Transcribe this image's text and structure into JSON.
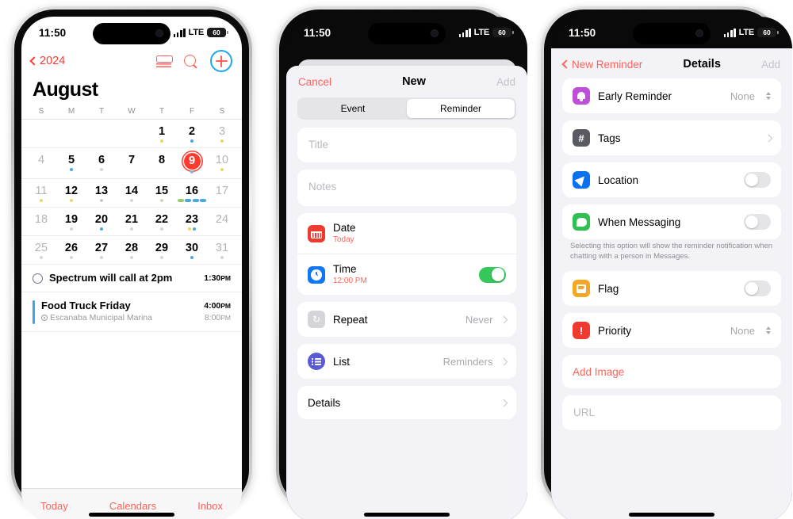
{
  "statusbar": {
    "time": "11:50",
    "network": "LTE",
    "battery": "60"
  },
  "phone1": {
    "nav": {
      "back_label": "2024",
      "icons": [
        "list-icon",
        "search-icon",
        "add-icon"
      ]
    },
    "month": "August",
    "weekday_headers": [
      "S",
      "M",
      "T",
      "W",
      "T",
      "F",
      "S"
    ],
    "weeks": [
      [
        {
          "n": "",
          "dim": true,
          "dots": []
        },
        {
          "n": "",
          "dim": true,
          "dots": []
        },
        {
          "n": "",
          "dim": true,
          "dots": []
        },
        {
          "n": "",
          "dim": true,
          "dots": []
        },
        {
          "n": "1",
          "dim": false,
          "dots": [
            "#e8d86a"
          ]
        },
        {
          "n": "2",
          "dim": false,
          "dots": [
            "#4aa8de"
          ]
        },
        {
          "n": "3",
          "dim": true,
          "dots": [
            "#e8d86a"
          ]
        }
      ],
      [
        {
          "n": "4",
          "dim": true,
          "dots": []
        },
        {
          "n": "5",
          "dim": false,
          "dots": [
            "#4aa8de"
          ]
        },
        {
          "n": "6",
          "dim": false,
          "dots": [
            "#d6d6da"
          ]
        },
        {
          "n": "7",
          "dim": false,
          "dots": []
        },
        {
          "n": "8",
          "dim": false,
          "dots": []
        },
        {
          "n": "9",
          "dim": false,
          "today": true,
          "dots": [
            "#8ab4e0"
          ]
        },
        {
          "n": "10",
          "dim": true,
          "dots": [
            "#e8d86a"
          ]
        }
      ],
      [
        {
          "n": "11",
          "dim": true,
          "dots": [
            "#e8d86a"
          ]
        },
        {
          "n": "12",
          "dim": false,
          "dots": [
            "#e8d86a"
          ]
        },
        {
          "n": "13",
          "dim": false,
          "dots": [
            "#c8c8cc"
          ]
        },
        {
          "n": "14",
          "dim": false,
          "dots": [
            "#d6d6da"
          ]
        },
        {
          "n": "15",
          "dim": false,
          "dots": [
            "#cfd6ae"
          ]
        },
        {
          "n": "16",
          "dim": false,
          "dots": [
            "#9bcb6e",
            "#4aa8de",
            "#4aa8de",
            "#4aa8de"
          ]
        },
        {
          "n": "17",
          "dim": true,
          "dots": []
        }
      ],
      [
        {
          "n": "18",
          "dim": true,
          "dots": []
        },
        {
          "n": "19",
          "dim": false,
          "dots": [
            "#d6d6da"
          ]
        },
        {
          "n": "20",
          "dim": false,
          "dots": [
            "#4aa8de"
          ]
        },
        {
          "n": "21",
          "dim": false,
          "dots": [
            "#d6d6da"
          ]
        },
        {
          "n": "22",
          "dim": false,
          "dots": [
            "#d6d6da"
          ]
        },
        {
          "n": "23",
          "dim": false,
          "dots": [
            "#e8d86a",
            "#4aa8de"
          ]
        },
        {
          "n": "24",
          "dim": true,
          "dots": []
        }
      ],
      [
        {
          "n": "25",
          "dim": true,
          "dots": [
            "#d6d6da"
          ]
        },
        {
          "n": "26",
          "dim": false,
          "dots": [
            "#d6d6da"
          ]
        },
        {
          "n": "27",
          "dim": false,
          "dots": [
            "#d6d6da"
          ]
        },
        {
          "n": "28",
          "dim": false,
          "dots": [
            "#d6d6da"
          ]
        },
        {
          "n": "29",
          "dim": false,
          "dots": [
            "#d6d6da"
          ]
        },
        {
          "n": "30",
          "dim": false,
          "dots": [
            "#4aa8de"
          ]
        },
        {
          "n": "31",
          "dim": true,
          "dots": [
            "#d6d6da"
          ]
        }
      ]
    ],
    "events": [
      {
        "kind": "reminder",
        "title": "Spectrum will call at 2pm",
        "location": "",
        "time": "1:30",
        "ampm": "PM",
        "time2": "",
        "ampm2": ""
      },
      {
        "kind": "event",
        "title": "Food Truck Friday",
        "location": "Escanaba Municipal Marina",
        "time": "4:00",
        "ampm": "PM",
        "time2": "8:00",
        "ampm2": "PM"
      }
    ],
    "tabbar": [
      "Today",
      "Calendars",
      "Inbox"
    ]
  },
  "phone2": {
    "nav": {
      "cancel": "Cancel",
      "title": "New",
      "add": "Add"
    },
    "segments": [
      {
        "label": "Event",
        "active": false
      },
      {
        "label": "Reminder",
        "active": true
      }
    ],
    "title_placeholder": "Title",
    "notes_placeholder": "Notes",
    "rows": [
      {
        "name": "date",
        "label": "Date",
        "sub": "Today",
        "icon": "calendar-icon"
      },
      {
        "name": "time",
        "label": "Time",
        "sub": "12:00 PM",
        "icon": "clock-icon",
        "toggle": "on"
      },
      {
        "name": "repeat",
        "label": "Repeat",
        "value": "Never",
        "icon": "repeat-icon",
        "chevron": true
      },
      {
        "name": "list",
        "label": "List",
        "value": "Reminders",
        "icon": "list-bullet-icon",
        "chevron": true
      },
      {
        "name": "details",
        "label": "Details",
        "value": "",
        "chevron": true
      }
    ]
  },
  "phone3": {
    "nav": {
      "back": "New Reminder",
      "title": "Details",
      "add": "Add"
    },
    "rows": [
      {
        "name": "early-reminder",
        "label": "Early Reminder",
        "value": "None",
        "icon": "bell-icon",
        "stepper": true
      },
      {
        "name": "tags",
        "label": "Tags",
        "icon": "hash-icon",
        "chevron": true
      },
      {
        "name": "location",
        "label": "Location",
        "icon": "location-icon",
        "toggle": "off"
      },
      {
        "name": "when-messaging",
        "label": "When Messaging",
        "icon": "message-icon",
        "toggle": "off"
      },
      {
        "name": "flag",
        "label": "Flag",
        "icon": "flag-icon",
        "toggle": "off"
      },
      {
        "name": "priority",
        "label": "Priority",
        "value": "None",
        "icon": "priority-icon",
        "stepper": true
      }
    ],
    "footnote": "Selecting this option will show the reminder notification when chatting with a person in Messages.",
    "add_image": "Add Image",
    "url_placeholder": "URL"
  }
}
